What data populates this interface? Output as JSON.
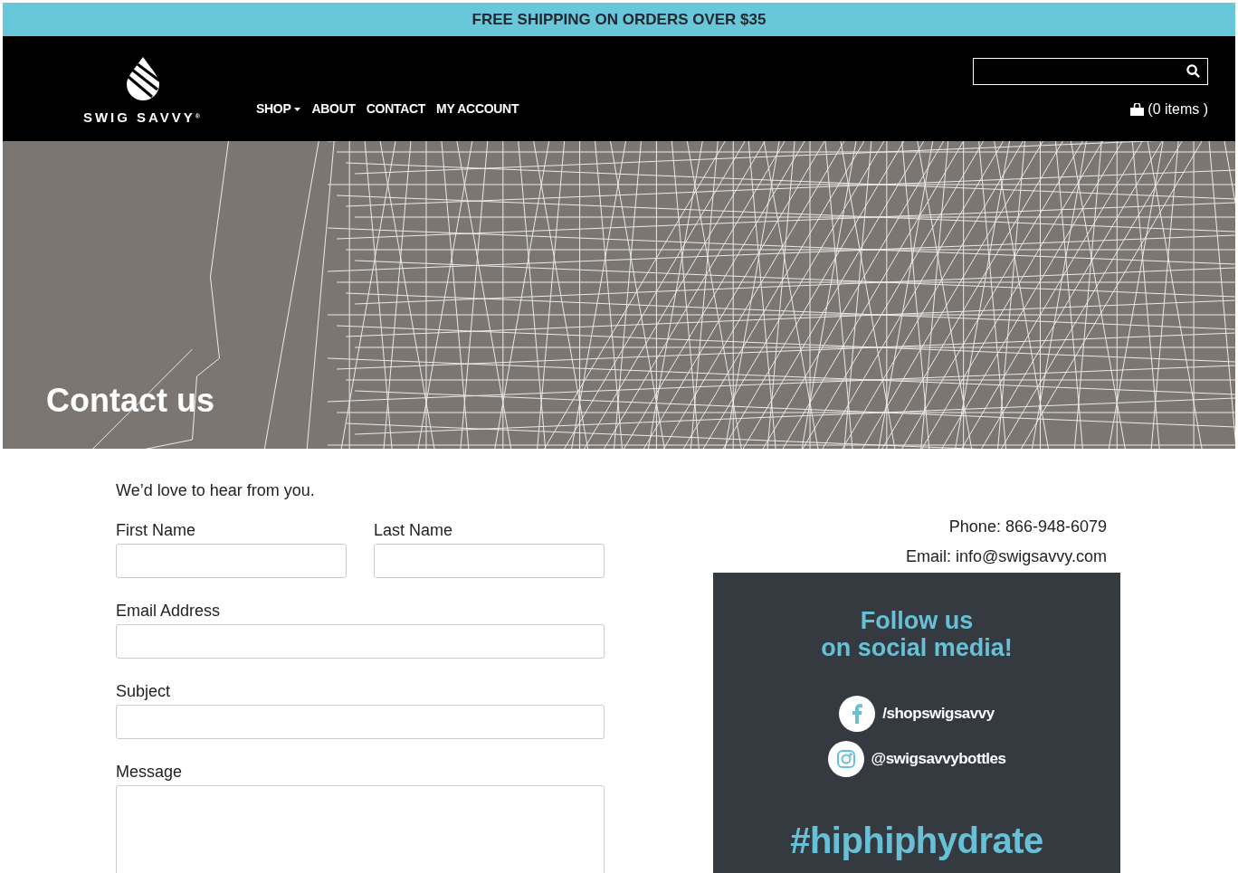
{
  "announcement": "FREE SHIPPING ON ORDERS OVER $35",
  "header": {
    "logo_text": "SWIG SAVVY",
    "logo_mark": "®",
    "nav": [
      {
        "label": "SHOP",
        "dropdown": true
      },
      {
        "label": "ABOUT",
        "dropdown": false
      },
      {
        "label": "CONTACT",
        "dropdown": false
      },
      {
        "label": "MY ACCOUNT",
        "dropdown": false
      }
    ],
    "cart": "(0 items )"
  },
  "hero": {
    "title": "Contact us"
  },
  "form": {
    "intro": "We’d love to hear from you.",
    "fields": [
      {
        "label": "First Name",
        "kind": "half"
      },
      {
        "label": "Last Name",
        "kind": "half"
      },
      {
        "label": "Email Address",
        "kind": "full"
      },
      {
        "label": "Subject",
        "kind": "full"
      },
      {
        "label": "Message",
        "kind": "area"
      }
    ]
  },
  "contact": {
    "phone": "Phone: 866-948-6079",
    "email": "Email: info@swigsavvy.com"
  },
  "social": {
    "title_lines": [
      "Follow us",
      "on social media!"
    ],
    "links": [
      {
        "kind": "facebook",
        "handle": "/shopswigsavvy"
      },
      {
        "kind": "instagram",
        "handle": "@swigsavvybottles"
      }
    ],
    "hashtag": "#hiphiphydrate"
  }
}
